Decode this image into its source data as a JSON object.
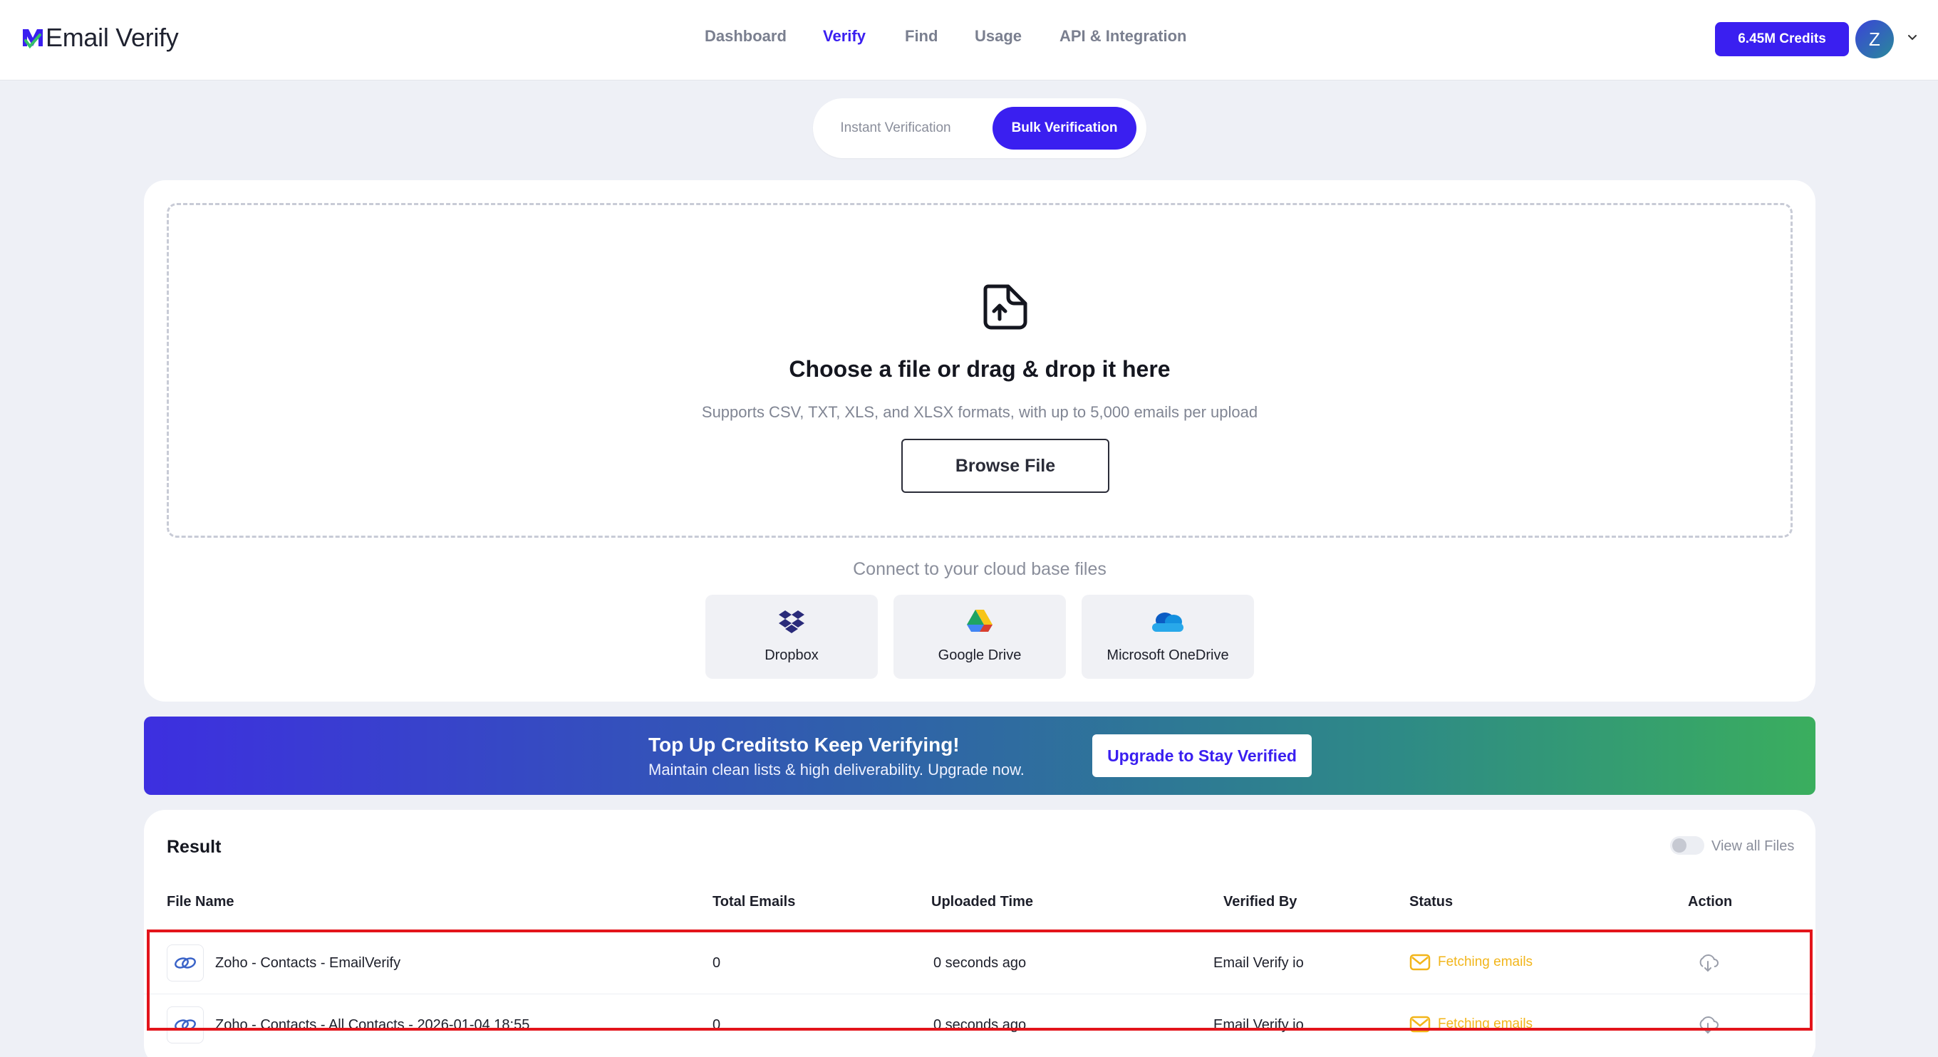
{
  "header": {
    "logo_text": "Email Verify",
    "nav": [
      {
        "label": "Dashboard",
        "active": false
      },
      {
        "label": "Verify",
        "active": true
      },
      {
        "label": "Find",
        "active": false
      },
      {
        "label": "Usage",
        "active": false
      },
      {
        "label": "API & Integration",
        "active": false
      }
    ],
    "credits_label": "6.45M Credits",
    "avatar_initial": "Z"
  },
  "tabs": {
    "instant": "Instant Verification",
    "bulk": "Bulk Verification"
  },
  "upload": {
    "title": "Choose a file or drag & drop it here",
    "subtitle": "Supports CSV, TXT, XLS, and XLSX formats, with up to 5,000 emails per upload",
    "browse_label": "Browse File",
    "cloud_heading": "Connect to your cloud base files",
    "cloud_sources": [
      {
        "label": "Dropbox",
        "icon": "dropbox-icon"
      },
      {
        "label": "Google Drive",
        "icon": "google-drive-icon"
      },
      {
        "label": "Microsoft OneDrive",
        "icon": "onedrive-icon"
      }
    ]
  },
  "banner": {
    "title": "Top Up Creditsto Keep Verifying!",
    "subtitle": "Maintain clean lists & high deliverability. Upgrade now.",
    "button": "Upgrade  to Stay Verified"
  },
  "result": {
    "title": "Result",
    "toggle_label": "View all Files",
    "columns": [
      "File Name",
      "Total Emails",
      "Uploaded Time",
      "Verified By",
      "Status",
      "Action"
    ],
    "rows": [
      {
        "file_name": "Zoho - Contacts - EmailVerify",
        "total_emails": "0",
        "uploaded_time": "0 seconds ago",
        "verified_by": "Email Verify io",
        "status": "Fetching emails"
      },
      {
        "file_name": "Zoho - Contacts - All Contacts - 2026-01-04 18:55",
        "total_emails": "0",
        "uploaded_time": "0 seconds ago",
        "verified_by": "Email Verify io",
        "status": "Fetching emails"
      }
    ]
  },
  "colors": {
    "primary": "#3a1ff0",
    "status_pending": "#f2b51a",
    "highlight": "#e3141b"
  }
}
